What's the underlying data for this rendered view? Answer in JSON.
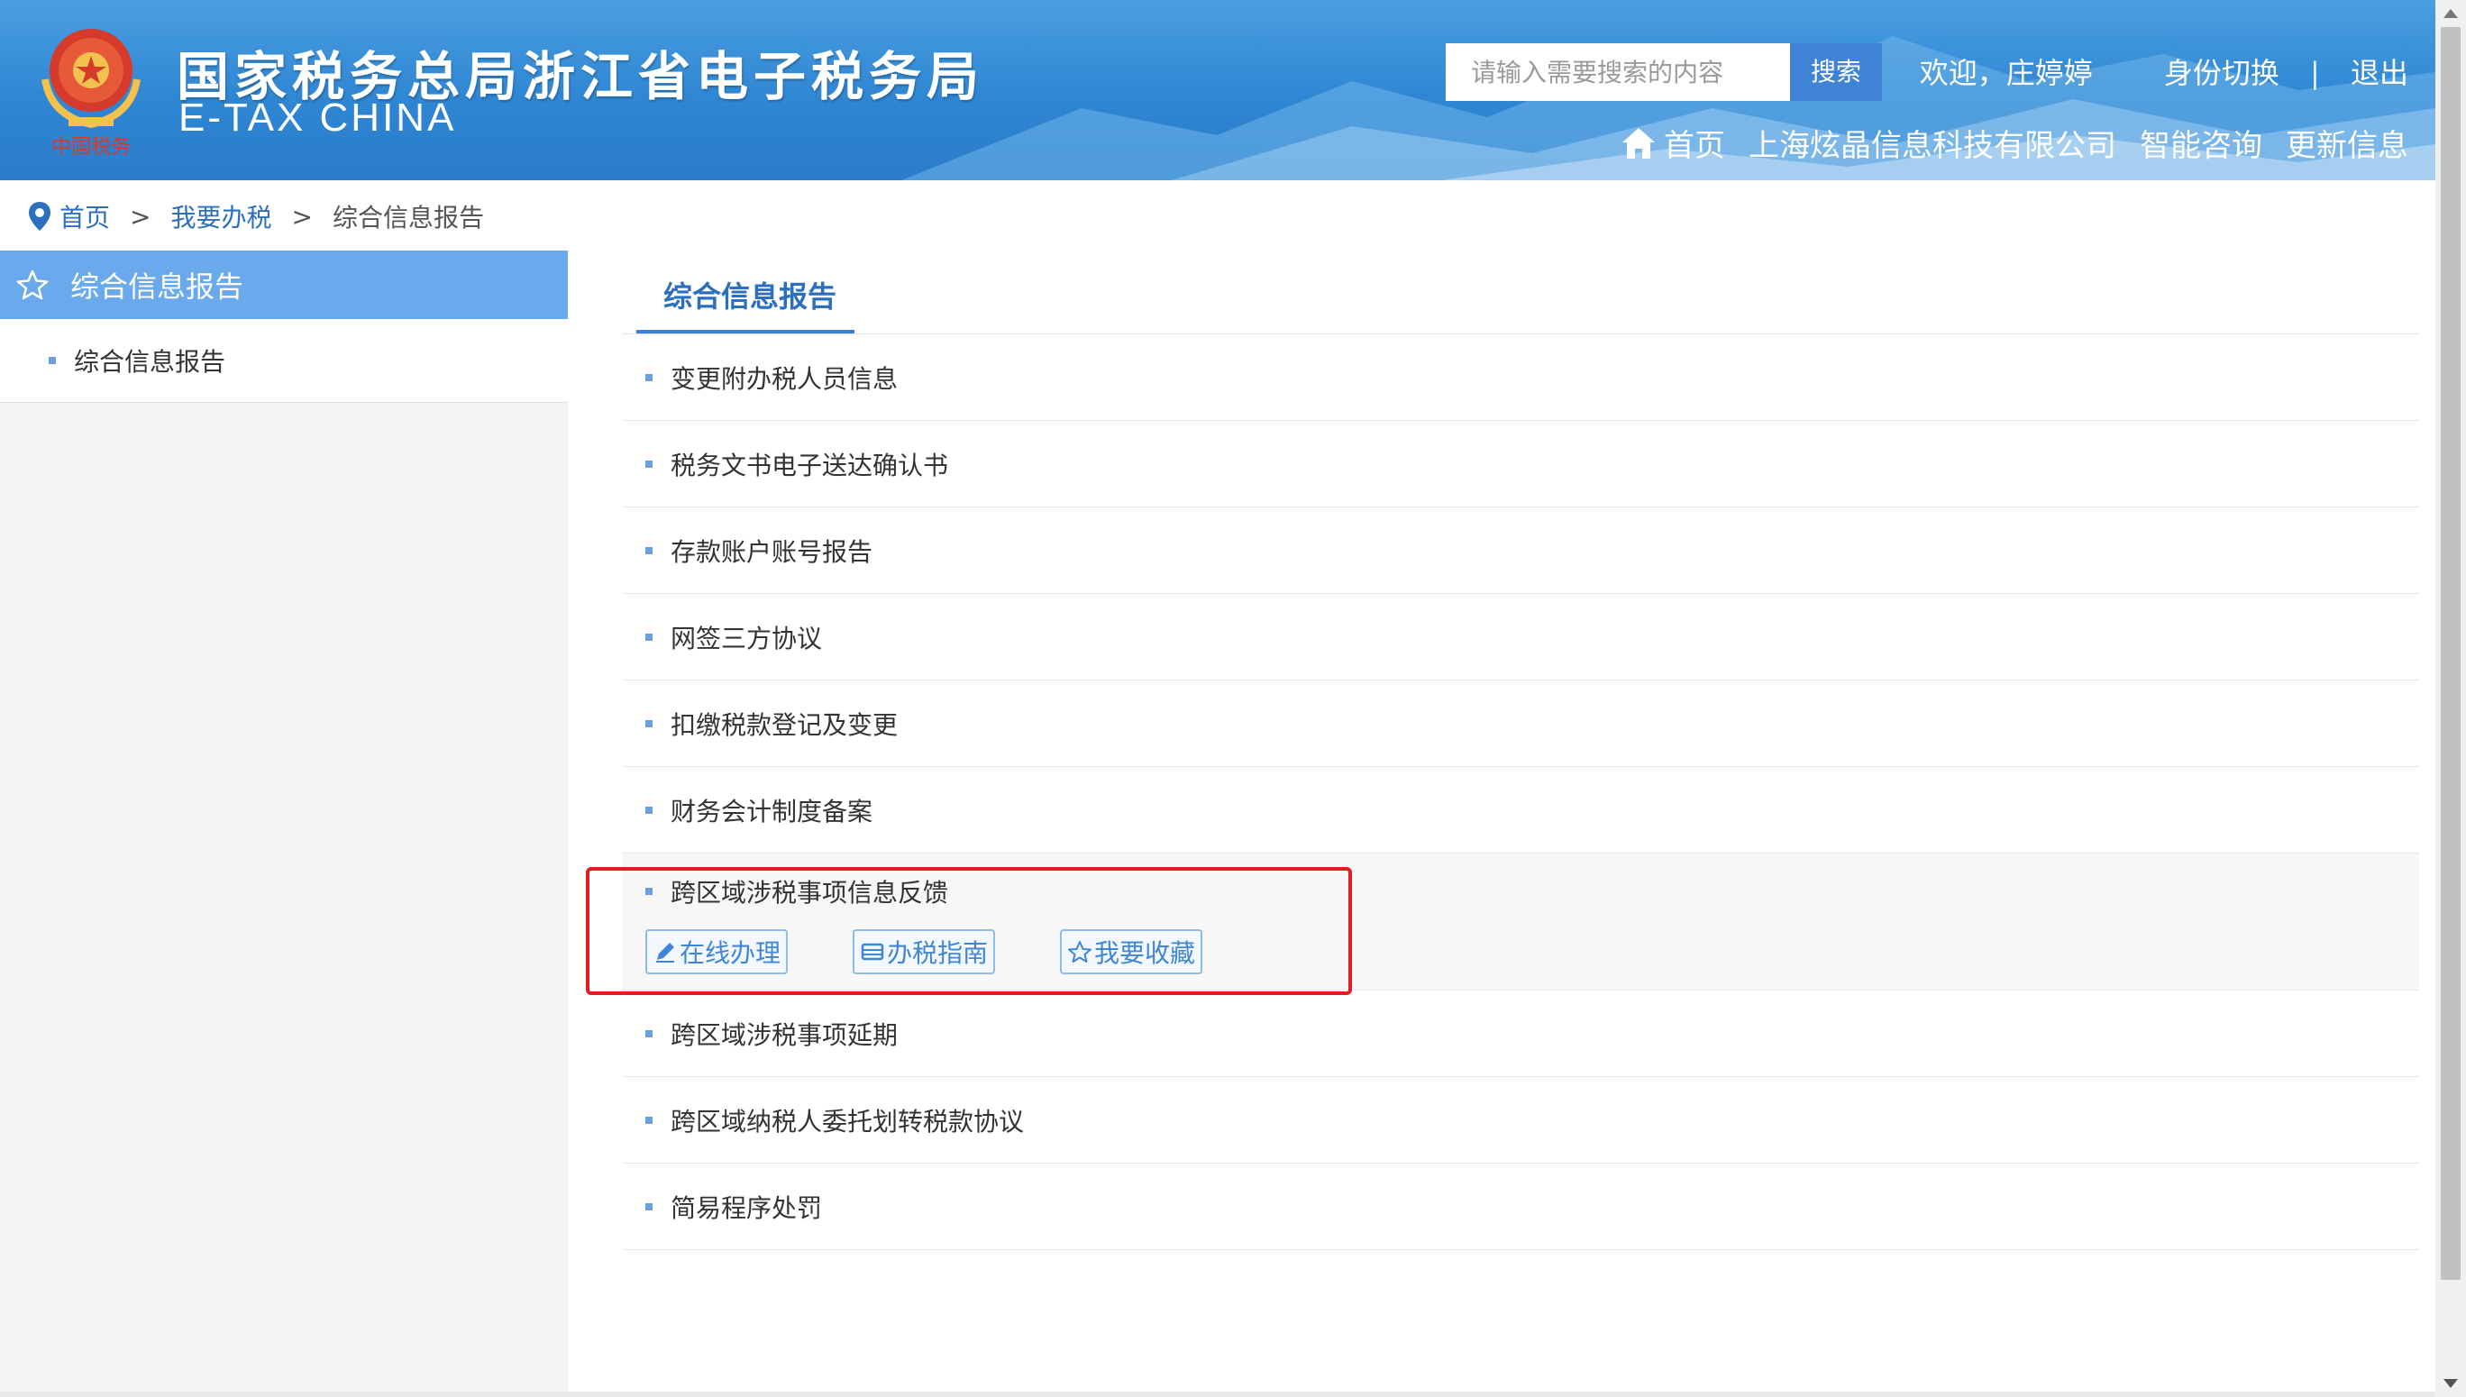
{
  "header": {
    "title": "国家税务总局浙江省电子税务局",
    "subtitle": "E-TAX CHINA",
    "search_placeholder": "请输入需要搜索的内容",
    "search_button": "搜索",
    "welcome": "欢迎，",
    "user_name": "庄婷婷",
    "switch_identity": "身份切换",
    "separator": "|",
    "logout": "退出",
    "nav": {
      "home": "首页",
      "company": "上海炫晶信息科技有限公司",
      "smart_consult": "智能咨询",
      "update_info": "更新信息"
    }
  },
  "breadcrumb": {
    "home": "首页",
    "tax_service": "我要办税",
    "current": "综合信息报告",
    "arrow": ">"
  },
  "sidebar": {
    "header": "综合信息报告",
    "items": [
      {
        "label": "综合信息报告"
      }
    ]
  },
  "main": {
    "tab_title": "综合信息报告",
    "items": [
      {
        "label": "变更附办税人员信息"
      },
      {
        "label": "税务文书电子送达确认书"
      },
      {
        "label": "存款账户账号报告"
      },
      {
        "label": "网签三方协议"
      },
      {
        "label": "扣缴税款登记及变更"
      },
      {
        "label": "财务会计制度备案"
      },
      {
        "label": "跨区域涉税事项信息反馈"
      },
      {
        "label": "跨区域涉税事项延期"
      },
      {
        "label": "跨区域纳税人委托划转税款协议"
      },
      {
        "label": "简易程序处罚"
      }
    ],
    "expanded_actions": {
      "online": "在线办理",
      "guide": "办税指南",
      "favorite": "我要收藏"
    }
  },
  "colors": {
    "header_blue": "#2f86d3",
    "sidebar_active": "#6aa9eb",
    "link_blue": "#2c6fbf",
    "highlight_red": "#e31b23"
  },
  "icons": {
    "emblem": "tax-emblem-icon",
    "home": "home-icon",
    "location": "location-pin-icon",
    "star": "star-icon",
    "edit": "pencil-icon",
    "guide": "book-icon",
    "favorite": "star-outline-icon"
  }
}
